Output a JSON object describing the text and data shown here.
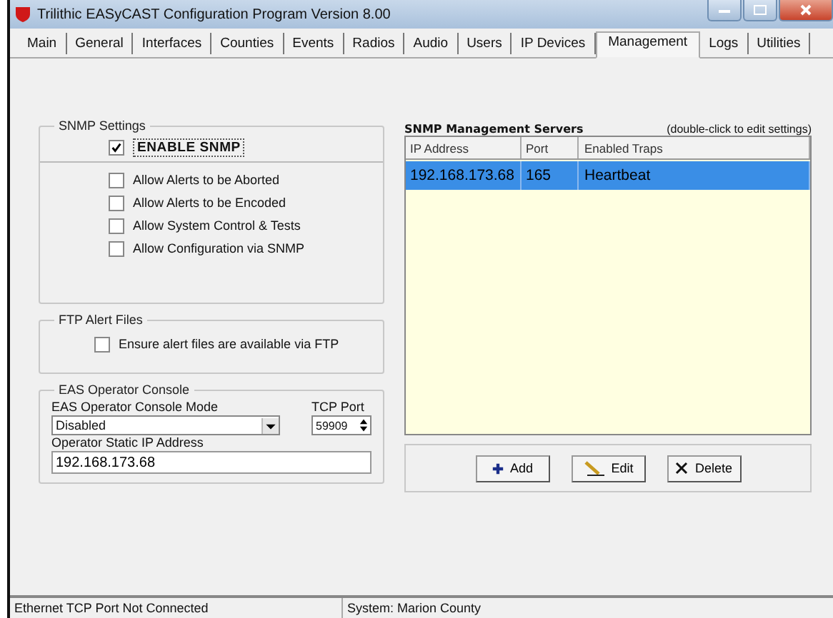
{
  "window": {
    "title": "Trilithic EASyCAST Configuration Program Version 8.00"
  },
  "tabs": [
    {
      "label": "Main",
      "selected": false
    },
    {
      "label": "General",
      "selected": false
    },
    {
      "label": "Interfaces",
      "selected": false
    },
    {
      "label": "Counties",
      "selected": false
    },
    {
      "label": "Events",
      "selected": false
    },
    {
      "label": "Radios",
      "selected": false
    },
    {
      "label": "Audio",
      "selected": false
    },
    {
      "label": "Users",
      "selected": false
    },
    {
      "label": "IP Devices",
      "selected": false
    },
    {
      "label": "Management",
      "selected": true
    },
    {
      "label": "Logs",
      "selected": false
    },
    {
      "label": "Utilities",
      "selected": false
    }
  ],
  "snmp_settings": {
    "title": "SNMP Settings",
    "enable": {
      "label": "ENABLE SNMP",
      "checked": true
    },
    "options": [
      {
        "label": "Allow Alerts to be Aborted",
        "checked": false
      },
      {
        "label": "Allow Alerts to be Encoded",
        "checked": false
      },
      {
        "label": "Allow System Control & Tests",
        "checked": false
      },
      {
        "label": "Allow Configuration via SNMP",
        "checked": false
      }
    ]
  },
  "ftp_alert_files": {
    "title": "FTP Alert Files",
    "option": {
      "label": "Ensure alert files are available via FTP",
      "checked": false
    }
  },
  "eas_operator_console": {
    "title": "EAS Operator Console",
    "mode_label": "EAS Operator Console Mode",
    "mode_value": "Disabled",
    "port_label": "TCP Port",
    "port_value": "59909",
    "ip_label": "Operator Static IP Address",
    "ip_value": "192.168.173.68"
  },
  "servers": {
    "title": "SNMP Management Servers",
    "hint": "(double-click to edit settings)",
    "columns": [
      "IP Address",
      "Port",
      "Enabled Traps"
    ],
    "rows": [
      {
        "cells": [
          "192.168.173.68",
          "165",
          "Heartbeat"
        ],
        "selected": true
      }
    ],
    "buttons": [
      {
        "label": "Add",
        "kind": "add"
      },
      {
        "label": "Edit",
        "kind": "edit"
      },
      {
        "label": "Delete",
        "kind": "delete"
      }
    ]
  },
  "status_bar": [
    "Ethernet TCP Port Not Connected",
    "System: Marion County"
  ]
}
